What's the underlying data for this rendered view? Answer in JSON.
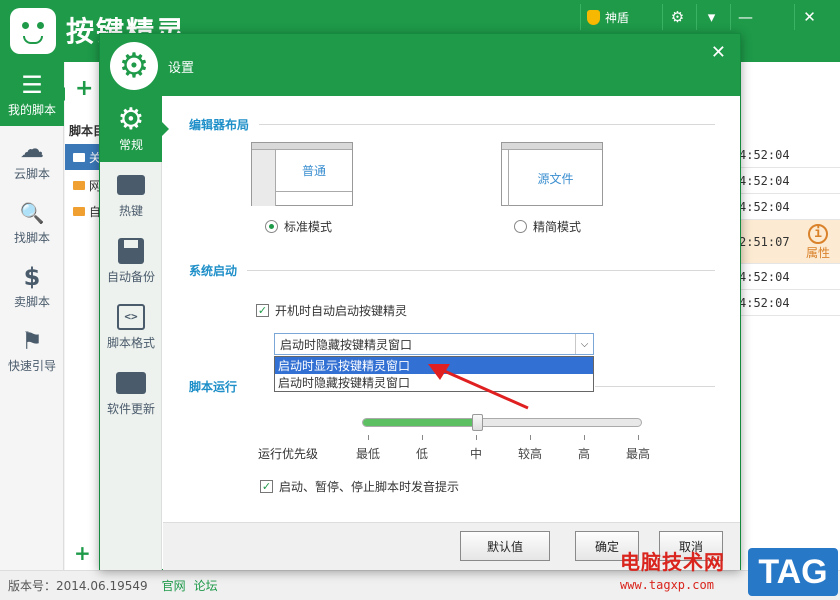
{
  "app": {
    "title": "按键精灵",
    "shield_label": "神盾",
    "controls": [
      "⚙",
      "▾",
      "—",
      "✕"
    ],
    "sidebar": [
      {
        "label": "我的脚本",
        "icon": "list-icon",
        "glyph": "☰",
        "active": true
      },
      {
        "label": "云脚本",
        "icon": "cloud-icon",
        "glyph": "☁",
        "active": false
      },
      {
        "label": "找脚本",
        "icon": "magnifier-icon",
        "glyph": "🔍",
        "active": false
      },
      {
        "label": "卖脚本",
        "icon": "dollar-icon",
        "glyph": "$",
        "active": false
      },
      {
        "label": "快速引导",
        "icon": "signpost-icon",
        "glyph": "⚑",
        "active": false
      }
    ],
    "tree_header": "脚本目",
    "tree_rows": [
      {
        "label": "关",
        "selected": true
      },
      {
        "label": "网",
        "selected": false
      },
      {
        "label": "自",
        "selected": false
      }
    ],
    "times": [
      "4:52:04",
      "4:52:04",
      "4:52:04",
      "2:51:07",
      "4:52:04",
      "4:52:04"
    ],
    "property_label": "属性",
    "version_label": "版本号：2014.06.19549",
    "links": [
      "官网",
      "论坛"
    ]
  },
  "dialog": {
    "title": "设置",
    "nav": [
      {
        "label": "常规",
        "icon": "gear-icon",
        "active": true
      },
      {
        "label": "热键",
        "icon": "keyboard-icon",
        "active": false
      },
      {
        "label": "自动备份",
        "icon": "save-disk-icon",
        "active": false
      },
      {
        "label": "脚本格式",
        "icon": "code-icon",
        "active": false
      },
      {
        "label": "软件更新",
        "icon": "update-tray-icon",
        "active": false
      }
    ],
    "editor_layout": {
      "title": "编辑器布局",
      "standard_thumb": "普通",
      "simple_thumb": "源文件",
      "standard_label": "标准模式",
      "simple_label": "精简模式",
      "selected": "standard"
    },
    "startup": {
      "title": "系统启动",
      "autostart_label": "开机时自动启动按键精灵",
      "autostart_checked": true,
      "select_value": "启动时隐藏按键精灵窗口",
      "options": [
        "启动时显示按键精灵窗口",
        "启动时隐藏按键精灵窗口"
      ],
      "highlighted_option": 0
    },
    "script_run": {
      "title": "脚本运行",
      "priority_label": "运行优先级",
      "levels": [
        "最低",
        "低",
        "中",
        "较高",
        "高",
        "最高"
      ],
      "level_index": 2,
      "sound_label": "启动、暂停、停止脚本时发音提示",
      "sound_checked": true
    },
    "buttons": {
      "default": "默认值",
      "ok": "确定",
      "cancel": "取消"
    }
  },
  "watermark": {
    "line1": "电脑技术网",
    "line2": "www.tagxp.com",
    "tag": "TAG"
  },
  "colors": {
    "brand_green": "#1e9a49",
    "section_blue": "#1e8fc8",
    "select_blue": "#3370d3",
    "arrow_red": "#e02020"
  }
}
